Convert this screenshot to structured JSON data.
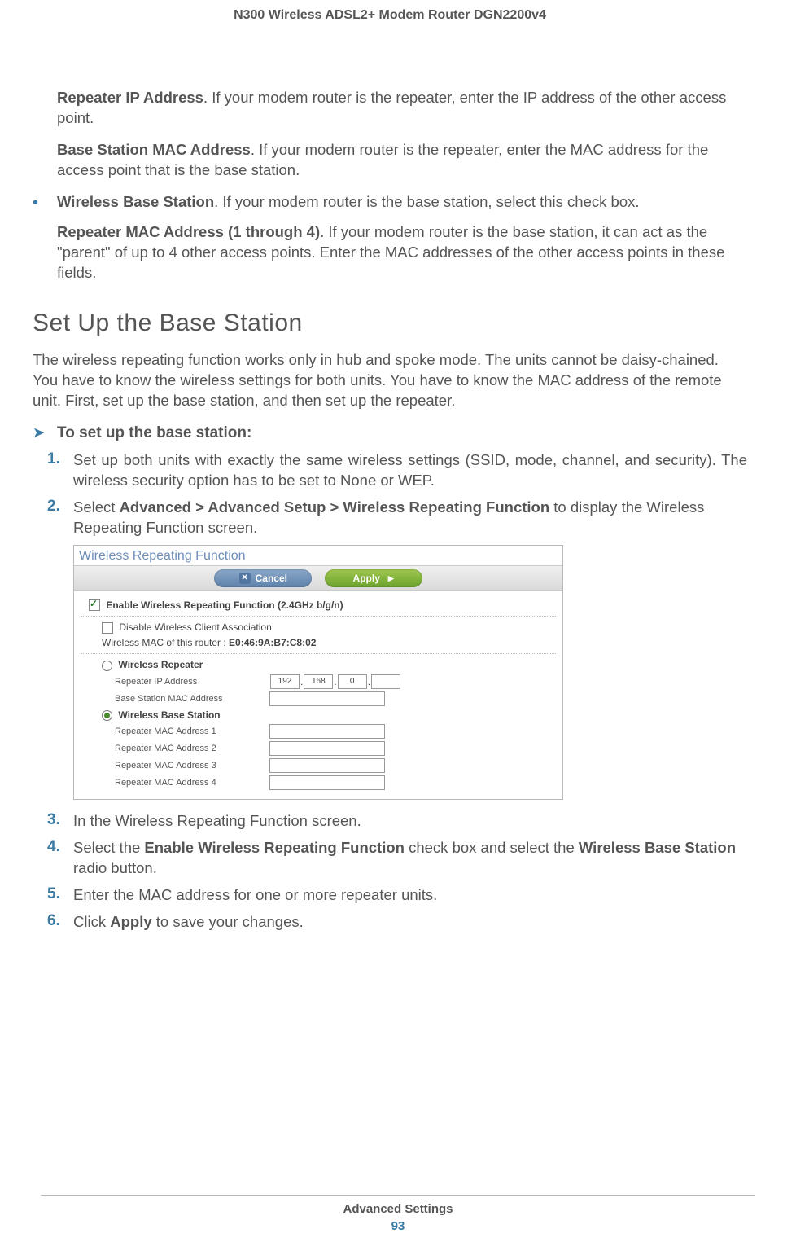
{
  "header": "N300 Wireless ADSL2+ Modem Router DGN2200v4",
  "p_repeater_ip_bold": "Repeater IP Address",
  "p_repeater_ip_rest": ". If your modem router is the repeater, enter the IP address of the other access point.",
  "p_base_mac_bold": "Base Station MAC Address",
  "p_base_mac_rest": ". If your modem router is the repeater, enter the MAC address for the access point that is the base station.",
  "bullet_wbs_bold": "Wireless Base Station",
  "bullet_wbs_rest": ". If your modem router is the base station, select this check box.",
  "p_rep_mac_bold": "Repeater MAC Address (1 through 4)",
  "p_rep_mac_rest": ". If your modem router is the base station, it can act as the \"parent\" of up to 4 other access points. Enter the MAC addresses of the other access points in these fields.",
  "section_heading": "Set Up the Base Station",
  "section_para": "The wireless repeating function works only in hub and spoke mode. The units cannot be daisy-chained. You have to know the wireless settings for both units. You have to know the MAC address of the remote unit. First, set up the base station, and then set up the repeater.",
  "proc_title": "To set up the base station:",
  "steps": {
    "s1": "Set up both units with exactly the same wireless settings (SSID, mode, channel, and security). The wireless security option has to be set to None or WEP.",
    "s2_a": "Select ",
    "s2_b": "Advanced > Advanced Setup > Wireless Repeating Function",
    "s2_c": " to display the Wireless Repeating Function screen.",
    "s3": "In the Wireless Repeating Function screen.",
    "s4_a": "Select the ",
    "s4_b": "Enable Wireless Repeating Function",
    "s4_c": " check box and select the ",
    "s4_d": "Wireless Base Station",
    "s4_e": " radio button.",
    "s5": "Enter the MAC address for one or more repeater units.",
    "s6_a": "Click ",
    "s6_b": "Apply",
    "s6_c": " to save your changes."
  },
  "nums": {
    "n1": "1.",
    "n2": "2.",
    "n3": "3.",
    "n4": "4.",
    "n5": "5.",
    "n6": "6."
  },
  "ui": {
    "title": "Wireless Repeating Function",
    "cancel": "Cancel",
    "apply": "Apply",
    "enable": "Enable Wireless Repeating Function (2.4GHz b/g/n)",
    "disable_assoc": "Disable Wireless Client Association",
    "mac_prefix": "Wireless MAC of this router : ",
    "mac_value": "E0:46:9A:B7:C8:02",
    "opt_repeater": "Wireless Repeater",
    "repeater_ip_label": "Repeater IP Address",
    "ip_a": "192",
    "ip_b": "168",
    "ip_c": "0",
    "base_mac_label": "Base Station MAC Address",
    "opt_base": "Wireless Base Station",
    "rm1": "Repeater MAC Address 1",
    "rm2": "Repeater MAC Address 2",
    "rm3": "Repeater MAC Address 3",
    "rm4": "Repeater MAC Address 4"
  },
  "footer_section": "Advanced Settings",
  "footer_page": "93"
}
